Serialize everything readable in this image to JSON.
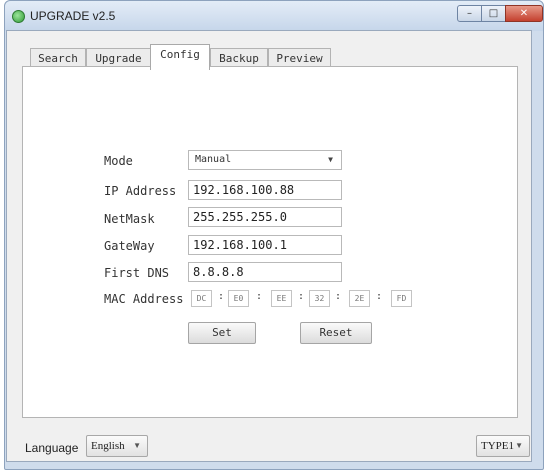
{
  "window": {
    "title": "UPGRADE v2.5"
  },
  "titlebar_controls": {
    "minimize": "–",
    "maximize": "□",
    "close": "✕"
  },
  "tabs": [
    {
      "label": "Search"
    },
    {
      "label": "Upgrade"
    },
    {
      "label": "Config",
      "active": true
    },
    {
      "label": "Backup"
    },
    {
      "label": "Preview"
    }
  ],
  "config": {
    "mode": {
      "label": "Mode",
      "value": "Manual"
    },
    "ip": {
      "label": "IP Address",
      "value": "192.168.100.88"
    },
    "netmask": {
      "label": "NetMask",
      "value": "255.255.255.0"
    },
    "gateway": {
      "label": "GateWay",
      "value": "192.168.100.1"
    },
    "dns": {
      "label": "First DNS",
      "value": "8.8.8.8"
    },
    "mac": {
      "label": "MAC Address",
      "separator": ":",
      "octets": [
        "DC",
        "E0",
        "EE",
        "32",
        "2E",
        "FD"
      ]
    },
    "set_label": "Set",
    "reset_label": "Reset"
  },
  "footer": {
    "language_label": "Language",
    "language_value": "English",
    "type_value": "TYPE1"
  },
  "icons": {
    "dropdown": "chevron-down-icon",
    "app": "app-icon"
  }
}
